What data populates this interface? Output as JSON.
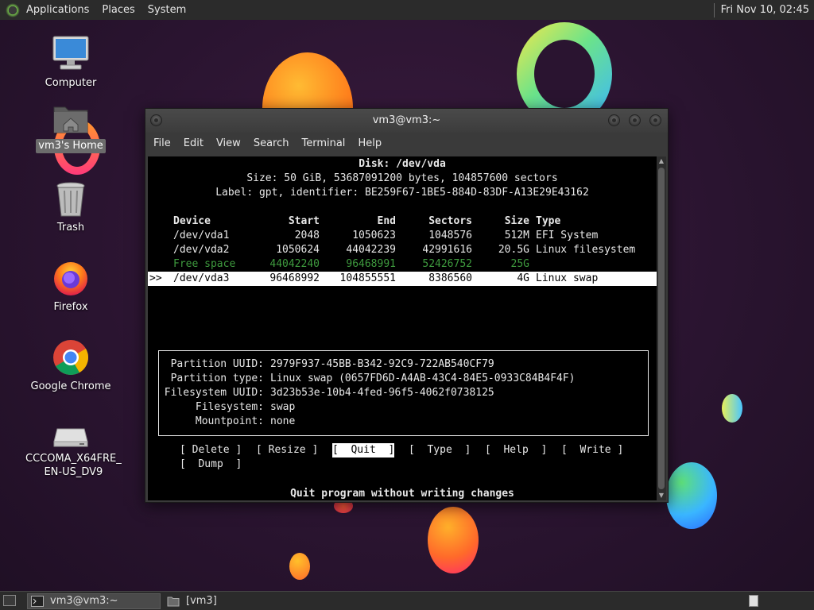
{
  "top_panel": {
    "menus": [
      "Applications",
      "Places",
      "System"
    ],
    "clock": "Fri Nov 10, 02:45"
  },
  "desktop_icons": [
    {
      "label": "Computer",
      "icon": "computer-icon"
    },
    {
      "label": "vm3's Home",
      "icon": "home-folder-icon",
      "selected": true
    },
    {
      "label": "Trash",
      "icon": "trash-icon"
    },
    {
      "label": "Firefox",
      "icon": "firefox-icon"
    },
    {
      "label": "Google Chrome",
      "icon": "chrome-icon"
    },
    {
      "label_line1": "CCCOMA_X64FRE_",
      "label_line2": "EN-US_DV9",
      "icon": "drive-icon"
    }
  ],
  "terminal": {
    "title": "vm3@vm3:~",
    "menus": [
      "File",
      "Edit",
      "View",
      "Search",
      "Terminal",
      "Help"
    ],
    "disk_header": "Disk: /dev/vda",
    "disk_size": "Size: 50 GiB, 53687091200 bytes, 104857600 sectors",
    "disk_label": "Label: gpt, identifier: BE259F67-1BE5-884D-83DF-A13E29E43162",
    "table_headers": {
      "device": "Device",
      "start": "Start",
      "end": "End",
      "sectors": "Sectors",
      "size": "Size",
      "type": "Type"
    },
    "rows": [
      {
        "marker": "",
        "device": "/dev/vda1",
        "start": "2048",
        "end": "1050623",
        "sectors": "1048576",
        "size": "512M",
        "type": "EFI System"
      },
      {
        "marker": "",
        "device": "/dev/vda2",
        "start": "1050624",
        "end": "44042239",
        "sectors": "42991616",
        "size": "20.5G",
        "type": "Linux filesystem"
      },
      {
        "marker": "",
        "device": "Free space",
        "start": "44042240",
        "end": "96468991",
        "sectors": "52426752",
        "size": "25G",
        "type": ""
      },
      {
        "marker": ">>",
        "device": "/dev/vda3",
        "start": "96468992",
        "end": "104855551",
        "sectors": "8386560",
        "size": "4G",
        "type": "Linux swap"
      }
    ],
    "info": [
      {
        "key": "Partition UUID:",
        "value": "2979F937-45BB-B342-92C9-722AB540CF79"
      },
      {
        "key": "Partition type:",
        "value": "Linux swap (0657FD6D-A4AB-43C4-84E5-0933C84B4F4F)"
      },
      {
        "key": "Filesystem UUID:",
        "value": "3d23b53e-10b4-4fed-96f5-4062f0738125"
      },
      {
        "key": "Filesystem:",
        "value": "swap"
      },
      {
        "key": "Mountpoint:",
        "value": "none"
      }
    ],
    "actions": [
      "[ Delete ]",
      "[ Resize ]",
      "[  Quit  ]",
      "[  Type  ]",
      "[  Help  ]",
      "[  Write ]",
      "[  Dump  ]"
    ],
    "selected_action": "[  Quit  ]",
    "status": "Quit program without writing changes"
  },
  "bottom_panel": {
    "tasks": [
      "vm3@vm3:~",
      "[vm3]"
    ]
  },
  "colors": {
    "free_space": "#3e9a3e",
    "panel_bg": "#2b2b2b",
    "terminal_bg": "#000000"
  }
}
